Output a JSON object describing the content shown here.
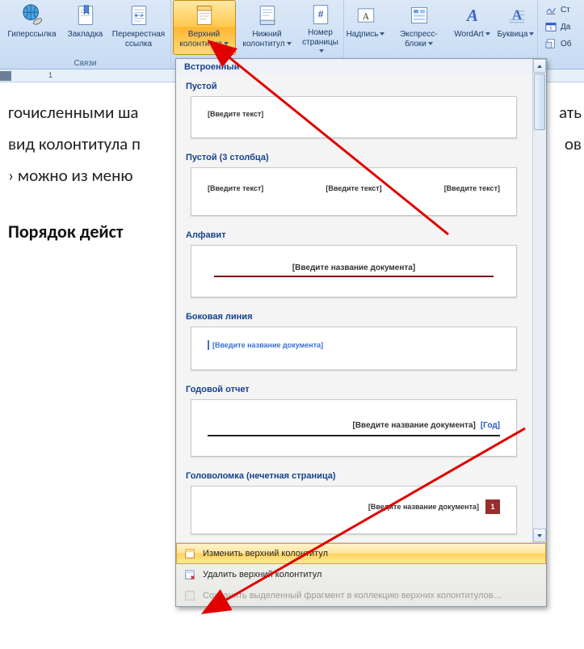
{
  "ribbon": {
    "groups": {
      "links": {
        "label": "Связи",
        "hyperlink": "Гиперссылка",
        "bookmark": "Закладка",
        "crossref": "Перекрестная ссылка"
      },
      "headerfooter": {
        "header": "Верхний колонтитул",
        "footer": "Нижний колонтитул",
        "pagenum": "Номер страницы"
      },
      "text": {
        "textbox": "Надпись",
        "quickparts": "Экспресс-блоки",
        "wordart": "WordArt",
        "dropcap": "Буквица"
      },
      "side": {
        "signature": "Ст",
        "datetime": "Да",
        "object": "Об"
      }
    }
  },
  "ruler": {
    "num1": "1"
  },
  "doc": {
    "line1": "гочисленными ша",
    "line1_right": "ать",
    "line2": "вид колонтитула п",
    "line2_right": "ов",
    "line3": "› можно из меню",
    "heading": "Порядок дейст"
  },
  "gallery": {
    "section_builtin": "Встроенный",
    "items": {
      "blank": {
        "title": "Пустой",
        "placeholder": "[Введите текст]"
      },
      "blank3": {
        "title": "Пустой (3 столбца)",
        "placeholder": "[Введите текст]"
      },
      "alphabet": {
        "title": "Алфавит",
        "placeholder": "[Введите название документа]"
      },
      "sideline": {
        "title": "Боковая линия",
        "placeholder": "[Введите название документа]"
      },
      "annual": {
        "title": "Годовой отчет",
        "placeholder": "[Введите название документа]",
        "year": "[Год]"
      },
      "puzzle": {
        "title": "Головоломка (нечетная страница)",
        "placeholder": "[Введите название документа]",
        "num": "1"
      }
    },
    "footer": {
      "edit": "Изменить верхний колонтитул",
      "remove": "Удалить верхний колонтитул",
      "save": "Сохранить выделенный фрагмент в коллекцию верхних колонтитулов…"
    }
  }
}
